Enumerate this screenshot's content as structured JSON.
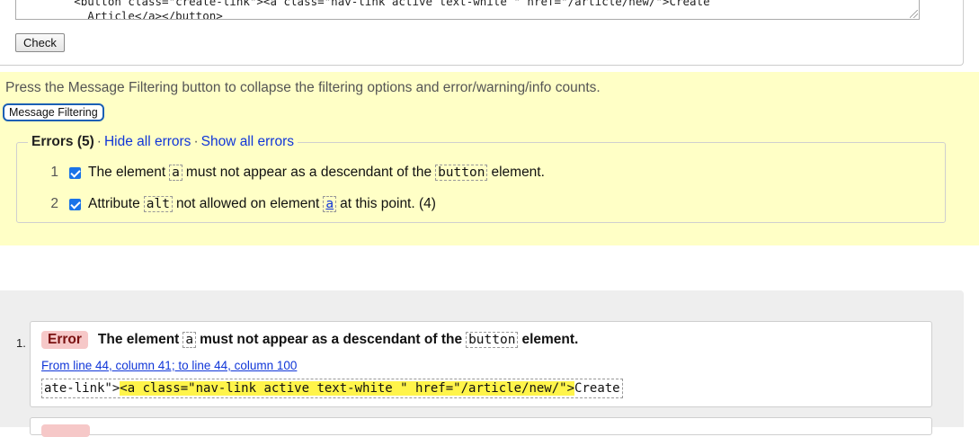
{
  "source": {
    "code_line1": "        <button class=\"create-link\"><a class=\"nav-link active text-white \" href=\"/article/new/\">Create",
    "code_line2": "          Article</a></button>",
    "check_label": "Check"
  },
  "filter": {
    "hint": "Press the Message Filtering button to collapse the filtering options and error/warning/info counts.",
    "button_label": "Message Filtering",
    "legend_title": "Errors (5)",
    "hide_all": "Hide all errors",
    "show_all": "Show all errors",
    "separator": "·",
    "items": [
      {
        "num": "1",
        "parts": [
          "The element",
          "a",
          "must not appear as a descendant of the",
          "button",
          "element."
        ]
      },
      {
        "num": "2",
        "parts": [
          "Attribute",
          "alt",
          "not allowed on element",
          "a",
          "at this point. (4)"
        ]
      }
    ]
  },
  "results": {
    "num": "1.",
    "badge": "Error",
    "msg_parts": [
      "The element",
      "a",
      "must not appear as a descendant of the",
      "button",
      "element."
    ],
    "location": "From line 44, column 41; to line 44, column 100",
    "extract_before": "ate-link\">",
    "extract_highlight": "<a class=\"nav-link active text-white \" href=\"/article/new/\">",
    "extract_after": "Create"
  },
  "colors": {
    "filter_bg": "#ffffc6",
    "link": "#1036d8",
    "error_badge_bg": "#f6c8c8",
    "highlight": "#fff44a",
    "results_bg": "#eeeeee"
  }
}
